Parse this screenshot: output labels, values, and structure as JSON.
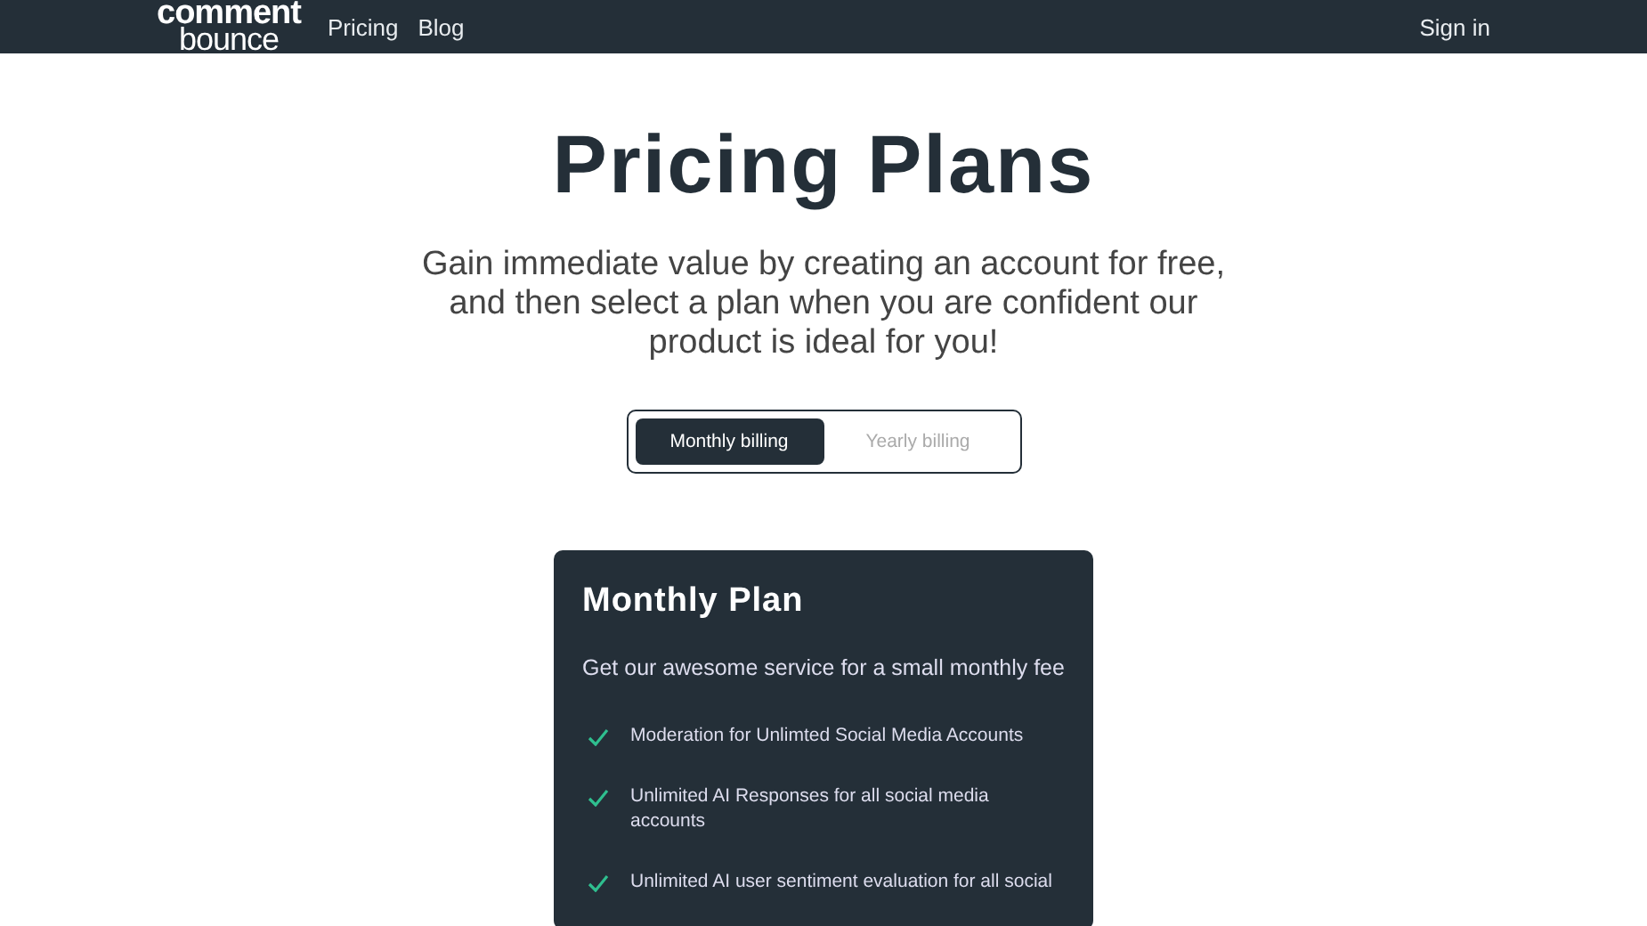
{
  "header": {
    "logo_top": "comment",
    "logo_bottom": "bounce",
    "nav": [
      {
        "label": "Pricing"
      },
      {
        "label": "Blog"
      }
    ],
    "sign_in": "Sign in"
  },
  "title": "Pricing Plans",
  "subtitle": "Gain immediate value by creating an account for free, and then select a plan when you are confident our product is ideal for you!",
  "billing_toggle": [
    {
      "label": "Monthly billing",
      "selected": true
    },
    {
      "label": "Yearly billing",
      "selected": false
    }
  ],
  "plan": {
    "name": "Monthly Plan",
    "description": "Get our awesome service for a small monthly fee",
    "features": [
      "Moderation for Unlimted Social Media Accounts",
      "Unlimited AI Responses for all social media accounts",
      "Unlimited AI user sentiment evaluation for all social"
    ]
  }
}
